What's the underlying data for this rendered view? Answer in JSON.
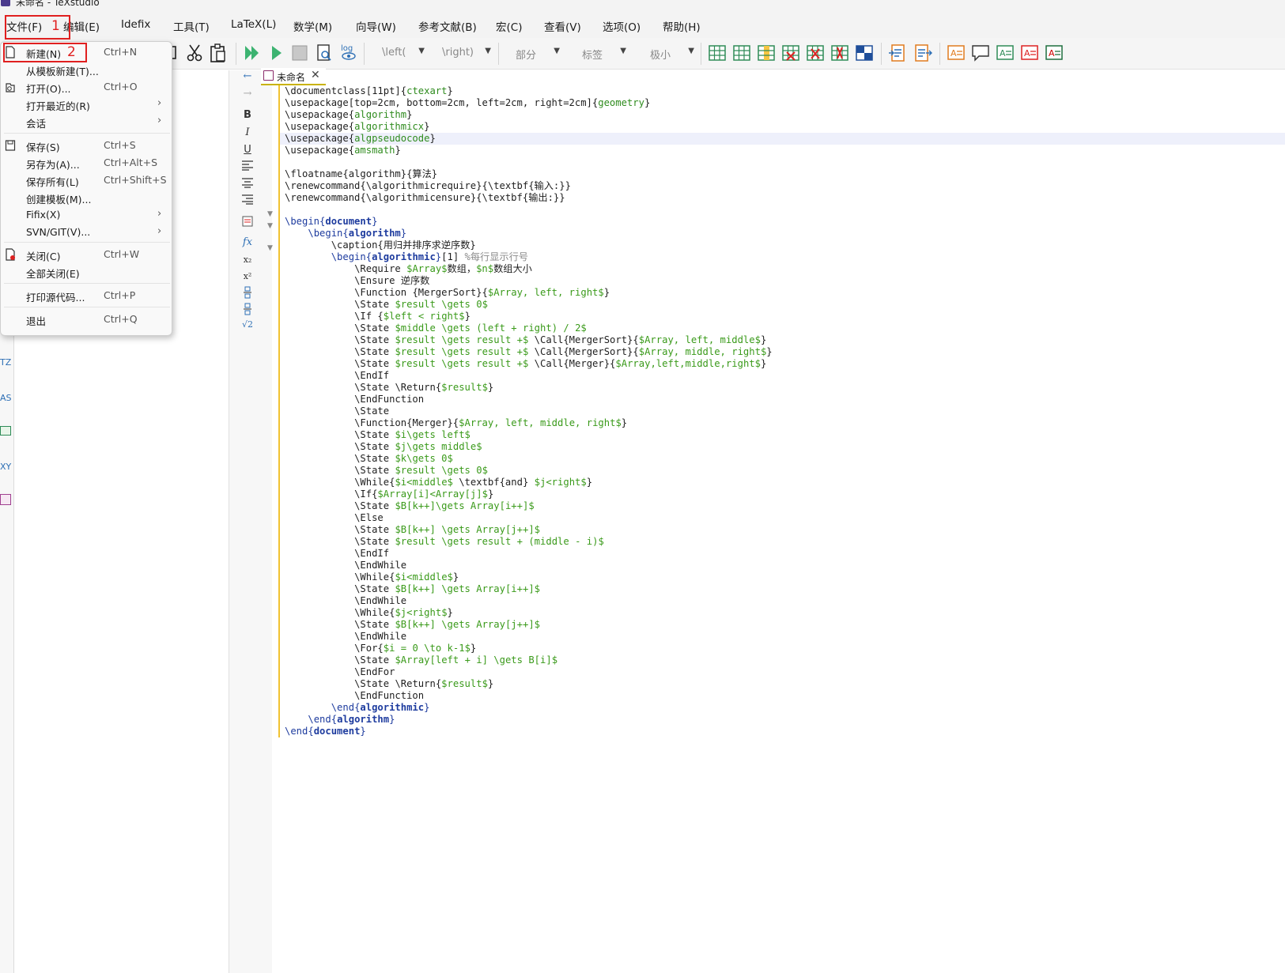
{
  "window": {
    "title": "未命名 - TeXstudio"
  },
  "menubar": {
    "items": [
      "文件(F)",
      "编辑(E)",
      "Idefix",
      "工具(T)",
      "LaTeX(L)",
      "数学(M)",
      "向导(W)",
      "参考文献(B)",
      "宏(C)",
      "查看(V)",
      "选项(O)",
      "帮助(H)"
    ]
  },
  "toolbar": {
    "combos": [
      "\\left(",
      "\\right)",
      "部分",
      "标签",
      "极小"
    ]
  },
  "dock": {
    "labels": [
      "TZ",
      "AS",
      "XY"
    ]
  },
  "tab": {
    "title": "未命名",
    "close": "✕"
  },
  "file_menu": {
    "items": [
      {
        "label": "新建(N)",
        "shortcut": "Ctrl+N",
        "icon": "new-file-icon"
      },
      {
        "label": "从模板新建(T)...",
        "shortcut": ""
      },
      {
        "label": "打开(O)...",
        "shortcut": "Ctrl+O",
        "icon": "open-icon"
      },
      {
        "label": "打开最近的(R)",
        "shortcut": "",
        "submenu": true
      },
      {
        "label": "会话",
        "shortcut": "",
        "submenu": true
      },
      {
        "label": "保存(S)",
        "shortcut": "Ctrl+S",
        "icon": "save-icon"
      },
      {
        "label": "另存为(A)...",
        "shortcut": "Ctrl+Alt+S"
      },
      {
        "label": "保存所有(L)",
        "shortcut": "Ctrl+Shift+S"
      },
      {
        "label": "创建模板(M)...",
        "shortcut": ""
      },
      {
        "label": "Fifix(X)",
        "shortcut": "",
        "submenu": true
      },
      {
        "label": "SVN/GIT(V)...",
        "shortcut": "",
        "submenu": true
      },
      {
        "label": "关闭(C)",
        "shortcut": "Ctrl+W",
        "icon": "close-file-icon"
      },
      {
        "label": "全部关闭(E)",
        "shortcut": ""
      },
      {
        "label": "打印源代码...",
        "shortcut": "Ctrl+P"
      },
      {
        "label": "退出",
        "shortcut": "Ctrl+Q"
      }
    ],
    "submenu_arrow": "›"
  },
  "annotations": {
    "first": "1",
    "second": "2"
  },
  "side_tools": [
    "←",
    "→",
    "B",
    "I",
    "U",
    "fx",
    "x₂",
    "x²",
    "√2"
  ],
  "editor": {
    "lines": [
      "\\documentclass[11pt]{ctexart}",
      "\\usepackage[top=2cm, bottom=2cm, left=2cm, right=2cm]{geometry}",
      "\\usepackage{algorithm}",
      "\\usepackage{algorithmicx}",
      "\\usepackage{algpseudocode}",
      "\\usepackage{amsmath}",
      "",
      "\\floatname{algorithm}{算法}",
      "\\renewcommand{\\algorithmicrequire}{\\textbf{输入:}}",
      "\\renewcommand{\\algorithmicensure}{\\textbf{输出:}}",
      "",
      "\\begin{document}",
      "    \\begin{algorithm}",
      "        \\caption{用归并排序求逆序数}",
      "        \\begin{algorithmic}[1] %每行显示行号",
      "            \\Require $Array$数组，$n$数组大小",
      "            \\Ensure 逆序数",
      "            \\Function {MergerSort}{$Array, left, right$}",
      "            \\State $result \\gets 0$",
      "            \\If {$left < right$}",
      "            \\State $middle \\gets (left + right) / 2$",
      "            \\State $result \\gets result +$ \\Call{MergerSort}{$Array, left, middle$}",
      "            \\State $result \\gets result +$ \\Call{MergerSort}{$Array, middle, right$}",
      "            \\State $result \\gets result +$ \\Call{Merger}{$Array,left,middle,right$}",
      "            \\EndIf",
      "            \\State \\Return{$result$}",
      "            \\EndFunction",
      "            \\State",
      "            \\Function{Merger}{$Array, left, middle, right$}",
      "            \\State $i\\gets left$",
      "            \\State $j\\gets middle$",
      "            \\State $k\\gets 0$",
      "            \\State $result \\gets 0$",
      "            \\While{$i<middle$ \\textbf{and} $j<right$}",
      "            \\If{$Array[i]<Array[j]$}",
      "            \\State $B[k++]\\gets Array[i++]$",
      "            \\Else",
      "            \\State $B[k++] \\gets Array[j++]$",
      "            \\State $result \\gets result + (middle - i)$",
      "            \\EndIf",
      "            \\EndWhile",
      "            \\While{$i<middle$}",
      "            \\State $B[k++] \\gets Array[i++]$",
      "            \\EndWhile",
      "            \\While{$j<right$}",
      "            \\State $B[k++] \\gets Array[j++]$",
      "            \\EndWhile",
      "            \\For{$i = 0 \\to k-1$}",
      "            \\State $Array[left + i] \\gets B[i]$",
      "            \\EndFor",
      "            \\State \\Return{$result$}",
      "            \\EndFunction",
      "        \\end{algorithmic}",
      "    \\end{algorithm}",
      "\\end{document}"
    ]
  }
}
